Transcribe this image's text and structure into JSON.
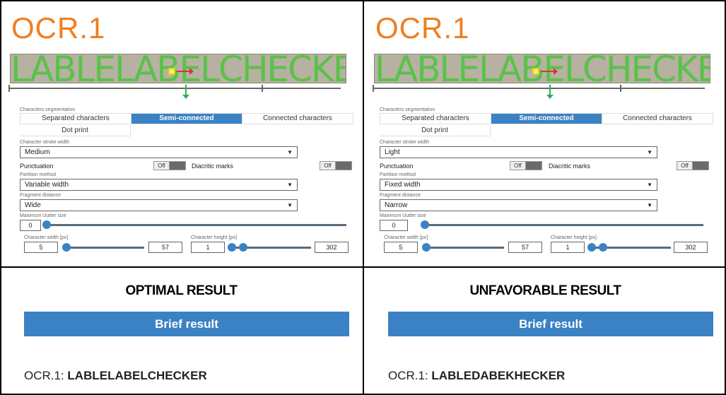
{
  "panels": [
    {
      "title": "OCR.1",
      "strip_text": "LABLELABELCHECKER",
      "segmentation_label": "Characters segmentation",
      "segments": [
        "Separated characters",
        "Semi-connected",
        "Connected characters"
      ],
      "active_segment": "Semi-connected",
      "dot_print": "Dot print",
      "stroke_label": "Character stroke width",
      "stroke_value": "Medium",
      "punctuation_label": "Punctuation",
      "punctuation_toggle": "Off",
      "diacritic_label": "Diacritic marks",
      "diacritic_toggle": "Off",
      "partition_label": "Partition method",
      "partition_value": "Variable width",
      "fragment_label": "Fragment distance",
      "fragment_value": "Wide",
      "clutter_label": "Maximum clutter size",
      "clutter_value": "0",
      "char_width_label": "Character width [px]",
      "char_width_min": "5",
      "char_width_max": "57",
      "char_height_label": "Character height [px]",
      "char_height_min": "1",
      "char_height_max": "302"
    },
    {
      "title": "OCR.1",
      "strip_text": "LABLELABELCHECKER",
      "segmentation_label": "Characters segmentation",
      "segments": [
        "Separated characters",
        "Semi-connected",
        "Connected characters"
      ],
      "active_segment": "Semi-connected",
      "dot_print": "Dot print",
      "stroke_label": "Character stroke width",
      "stroke_value": "Light",
      "punctuation_label": "Punctuation",
      "punctuation_toggle": "Off",
      "diacritic_label": "Diacritic marks",
      "diacritic_toggle": "Off",
      "partition_label": "Partition method",
      "partition_value": "Fixed width",
      "fragment_label": "Fragment distance",
      "fragment_value": "Narrow",
      "clutter_label": "Maximum clutter size",
      "clutter_value": "0",
      "char_width_label": "Character width [px]",
      "char_width_min": "5",
      "char_width_max": "57",
      "char_height_label": "Character height [px]",
      "char_height_min": "1",
      "char_height_max": "302"
    }
  ],
  "results": [
    {
      "heading": "OPTIMAL RESULT",
      "brief": "Brief result",
      "ocr_prefix": "OCR.1: ",
      "ocr_value": "LABLELABELCHECKER"
    },
    {
      "heading": "UNFAVORABLE RESULT",
      "brief": "Brief result",
      "ocr_prefix": "OCR.1: ",
      "ocr_value": "LABLEDABEKHECKER"
    }
  ],
  "colors": {
    "accent_blue": "#3a82c4",
    "ocr_orange": "#f07e1f",
    "strip_green": "#59c24a"
  }
}
